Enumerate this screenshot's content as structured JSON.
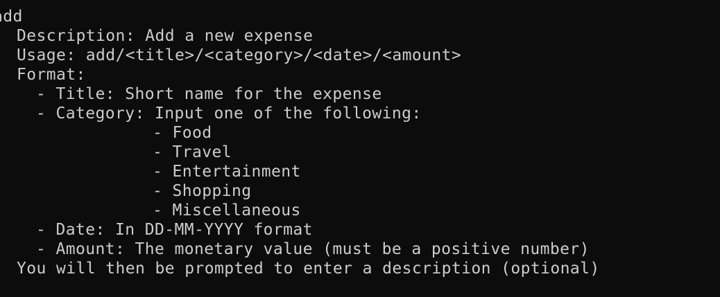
{
  "terminal": {
    "command": "add",
    "description_line": "Description: Add a new expense",
    "usage_line": "Usage: add/<title>/<category>/<date>/<amount>",
    "format_heading": "Format:",
    "title_line": "- Title: Short name for the expense",
    "category_line": "- Category: Input one of the following:",
    "categories": [
      "- Food",
      "- Travel",
      "- Entertainment",
      "- Shopping",
      "- Miscellaneous"
    ],
    "date_line": "- Date: In DD-MM-YYYY format",
    "amount_line": "- Amount: The monetary value (must be a positive number)",
    "prompt_note": "You will then be prompted to enter a description (optional)"
  },
  "colors": {
    "background": "#0c0c0c",
    "text": "#cccccc"
  }
}
